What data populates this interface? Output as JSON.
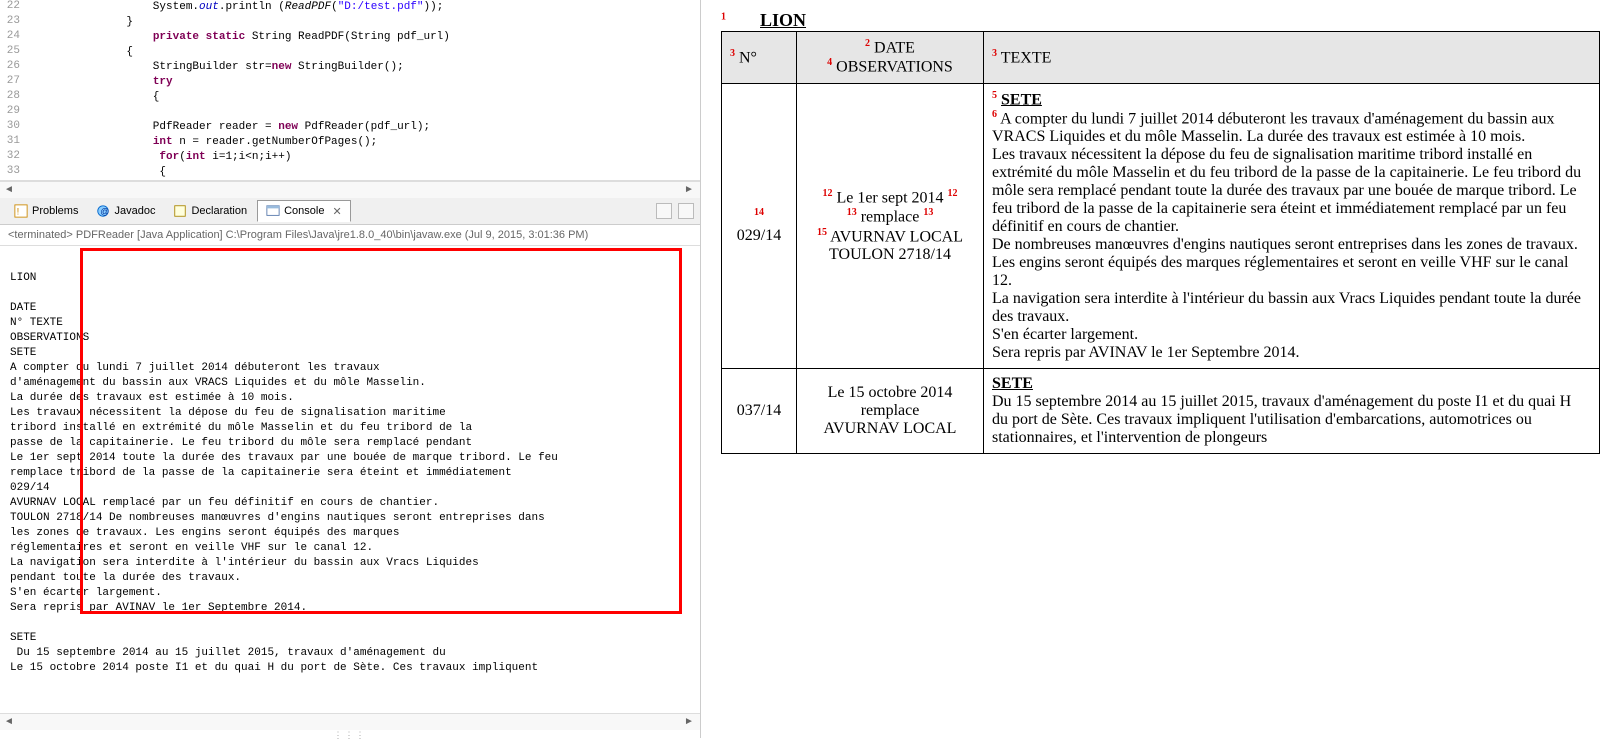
{
  "code": {
    "lines": [
      {
        "n": 22,
        "t": "            System.out.println (ReadPDF(\"D:/test.pdf\"));"
      },
      {
        "n": 23,
        "t": "        }"
      },
      {
        "n": 24,
        "t": "        private static String ReadPDF(String pdf_url)",
        "mark": true
      },
      {
        "n": 25,
        "t": "        {"
      },
      {
        "n": 26,
        "t": "            StringBuilder str=new StringBuilder();"
      },
      {
        "n": 27,
        "t": "            try"
      },
      {
        "n": 28,
        "t": "            {"
      },
      {
        "n": 29,
        "t": ""
      },
      {
        "n": 30,
        "t": "            PdfReader reader = new PdfReader(pdf_url);"
      },
      {
        "n": 31,
        "t": "            int n = reader.getNumberOfPages();"
      },
      {
        "n": 32,
        "t": "             for(int i=1;i<n;i++)"
      },
      {
        "n": 33,
        "t": "             {"
      }
    ]
  },
  "tabs": {
    "problems": "Problems",
    "javadoc": "Javadoc",
    "declaration": "Declaration",
    "console": "Console"
  },
  "console": {
    "status": "<terminated> PDFReader [Java Application] C:\\Program Files\\Java\\jre1.8.0_40\\bin\\javaw.exe (Jul 9, 2015, 3:01:36 PM)",
    "body": "\nLION\n\nDATE\nN° TEXTE\nOBSERVATIONS\nSETE\nA compter du lundi 7 juillet 2014 débuteront les travaux\nd'aménagement du bassin aux VRACS Liquides et du môle Masselin.\nLa durée des travaux est estimée à 10 mois.\nLes travaux nécessitent la dépose du feu de signalisation maritime\ntribord installé en extrémité du môle Masselin et du feu tribord de la\npasse de la capitainerie. Le feu tribord du môle sera remplacé pendant\nLe 1er sept 2014 toute la durée des travaux par une bouée de marque tribord. Le feu\nremplace tribord de la passe de la capitainerie sera éteint et immédiatement\n029/14\nAVURNAV LOCAL remplacé par un feu définitif en cours de chantier.\nTOULON 2718/14 De nombreuses manœuvres d'engins nautiques seront entreprises dans\nles zones de travaux. Les engins seront équipés des marques\nréglementaires et seront en veille VHF sur le canal 12.\nLa navigation sera interdite à l'intérieur du bassin aux Vracs Liquides\npendant toute la durée des travaux.\nS'en écarter largement.\nSera repris par AVINAV le 1er Septembre 2014.\n\nSETE\n Du 15 septembre 2014 au 15 juillet 2015, travaux d'aménagement du\nLe 15 octobre 2014 poste I1 et du quai H du port de Sète. Ces travaux impliquent"
  },
  "doc": {
    "title": "LION",
    "markers": {
      "m1": "1",
      "m2": "2",
      "m3": "3",
      "m4": "4",
      "m5": "5",
      "m6": "6",
      "m12": "12",
      "m13": "13",
      "m14": "14",
      "m15": "15"
    },
    "headers": {
      "num": "N°",
      "date": "DATE",
      "obs": "OBSERVATIONS",
      "texte": "TEXTE"
    },
    "rows": [
      {
        "num": "029/14",
        "date_l1": "Le 1er sept 2014",
        "date_l2": "remplace",
        "date_l3": "AVURNAV LOCAL",
        "date_l4": "TOULON 2718/14",
        "sete": "SETE",
        "texte": "A compter du lundi 7 juillet 2014 débuteront les travaux d'aménagement du bassin aux VRACS Liquides et du môle Masselin. La durée des travaux est estimée à 10 mois.\nLes travaux nécessitent la dépose du feu de signalisation maritime tribord installé en extrémité du môle Masselin et du feu tribord de la passe de la capitainerie. Le feu tribord du môle sera remplacé pendant toute la durée des travaux par une bouée de marque tribord. Le feu tribord de la passe de la capitainerie sera éteint et immédiatement remplacé par un feu définitif en cours de chantier.\nDe nombreuses manœuvres d'engins nautiques seront entreprises dans les zones de travaux. Les engins seront équipés des marques réglementaires et seront en veille VHF sur le canal 12.\nLa navigation sera interdite à l'intérieur du bassin aux Vracs Liquides pendant toute la durée des travaux.\nS'en écarter largement.\nSera repris par AVINAV le 1er Septembre 2014."
      },
      {
        "num": "037/14",
        "date_l1": "Le 15 octobre 2014",
        "date_l2": "remplace",
        "date_l3": "AVURNAV LOCAL",
        "sete": "SETE",
        "texte": "Du 15 septembre 2014 au 15 juillet 2015, travaux d'aménagement du poste I1 et du quai H du port de Sète. Ces travaux impliquent l'utilisation d'embarcations, automotrices ou stationnaires, et l'intervention de plongeurs"
      }
    ]
  }
}
